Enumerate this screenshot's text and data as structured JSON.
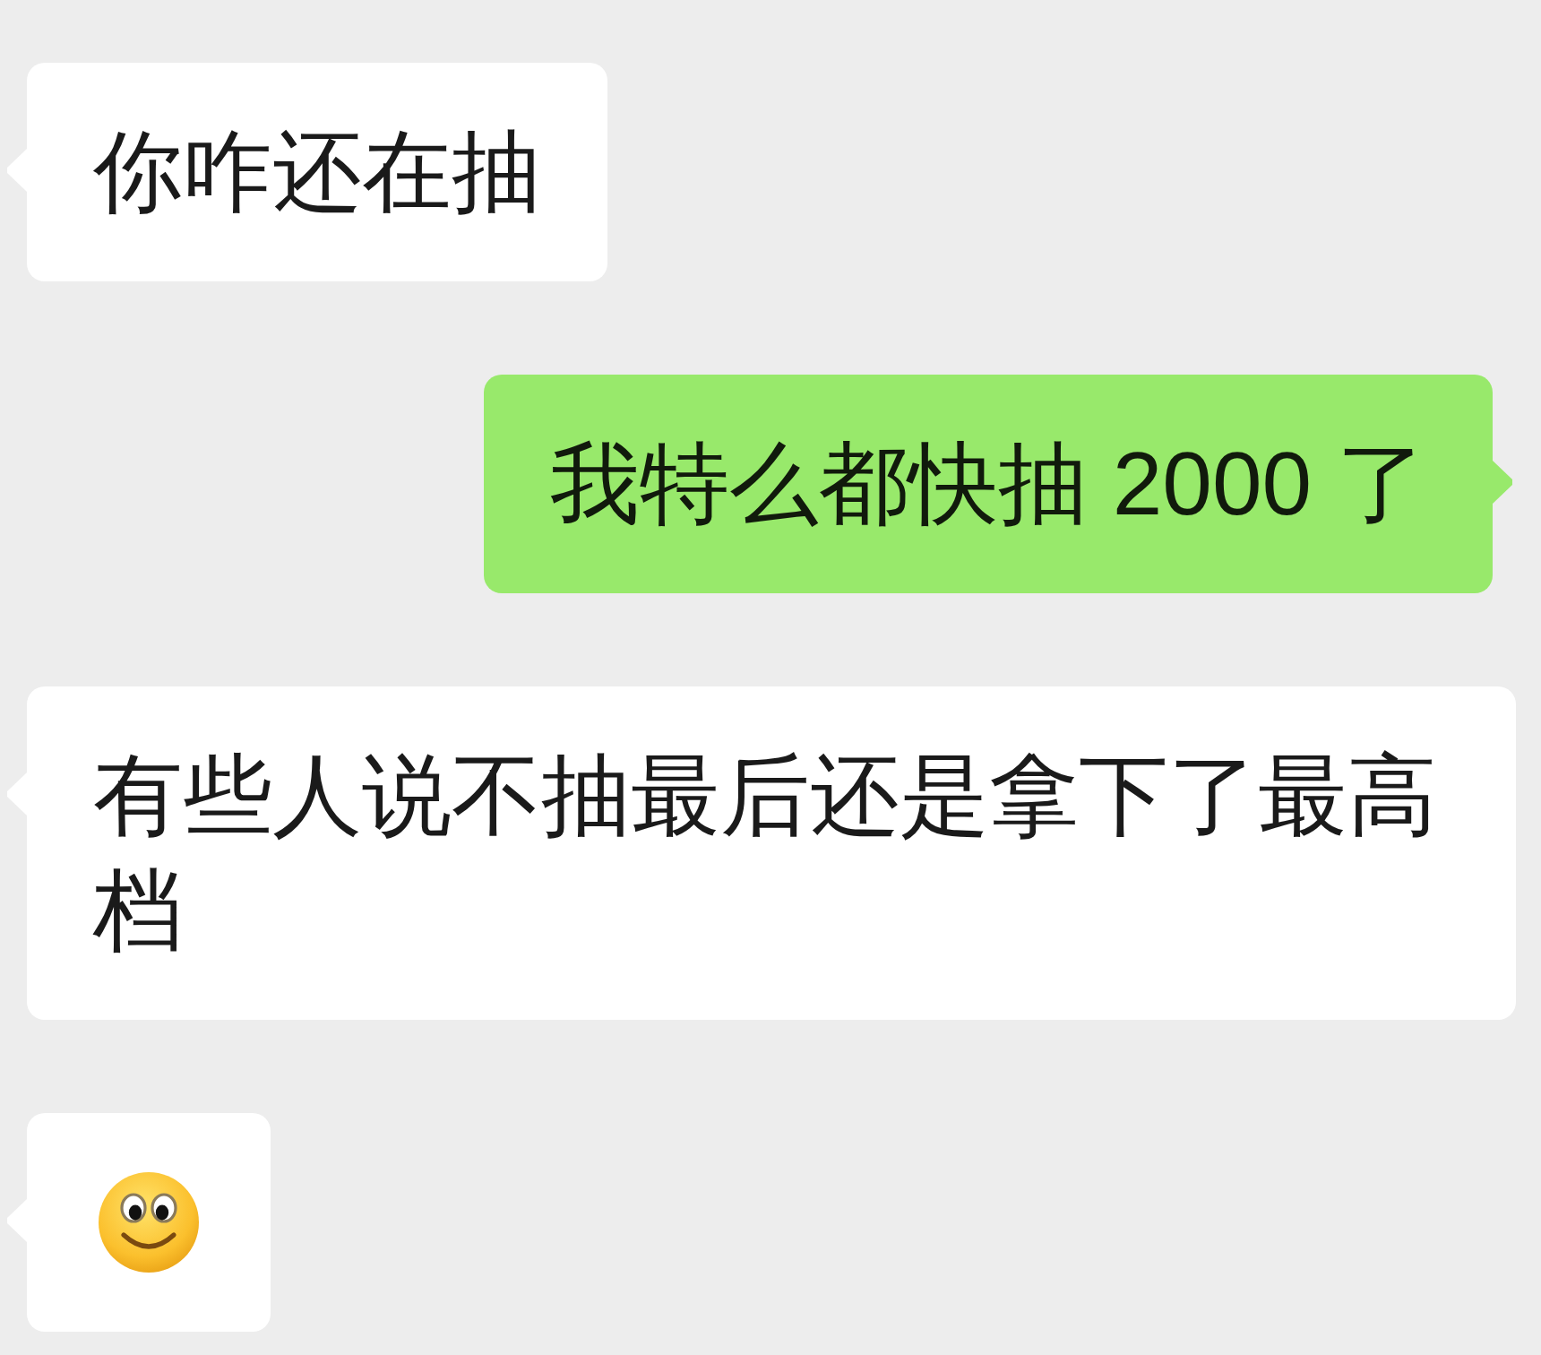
{
  "messages": [
    {
      "outgoing": false,
      "kind": "text",
      "text": "你咋还在抽"
    },
    {
      "outgoing": true,
      "kind": "text",
      "text": "我特么都快抽 2000 了"
    },
    {
      "outgoing": false,
      "kind": "text",
      "text": "有些人说不抽最后还是拿下了最高档"
    },
    {
      "outgoing": false,
      "kind": "emoji"
    }
  ]
}
